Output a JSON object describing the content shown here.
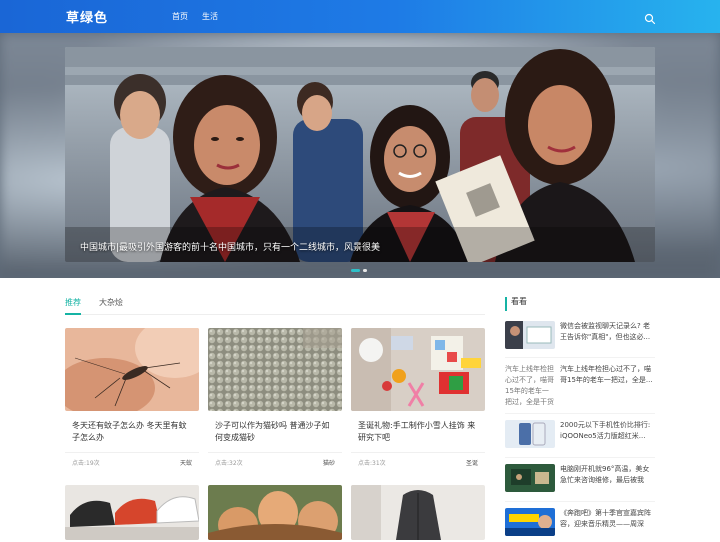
{
  "header": {
    "logo": "草绿色",
    "nav": [
      "首页",
      "生活"
    ]
  },
  "hero": {
    "caption": "中国城市|最吸引外国游客的前十名中国城市，只有一个二线城市，风景很美",
    "slide_count": 2,
    "active_slide": 1
  },
  "tabs": [
    "推荐",
    "大杂烩"
  ],
  "active_tab": 0,
  "cards": [
    {
      "title": "冬天还有蚊子怎么办 冬天里有蚊子怎么办",
      "clicks": "点击:19次",
      "category": "天蚁"
    },
    {
      "title": "沙子可以作为猫砂吗 普通沙子如何变成猫砂",
      "clicks": "点击:32次",
      "category": "猫砂"
    },
    {
      "title": "圣诞礼物:手工制作小雪人挂饰 来研究下吧",
      "clicks": "点击:31次",
      "category": "圣诞"
    }
  ],
  "sidebar": {
    "heading": "看看",
    "items": [
      {
        "text": "微信会被监视聊天记录么? 老王告诉你\"真相\"，但也这必..."
      },
      {
        "text": "汽车上线年检担心过不了，喵哥15年的老车一把过，全是...",
        "image_alt": "汽车上线年检担心过不了，喵哥15年的老车一把过，全是干货"
      },
      {
        "text": "2000元以下手机性价比排行: iQOONeo5活力版超红米..."
      },
      {
        "text": "电脑刚开机就96°高温，美女急忙来咨询维修，最后被我拍..."
      },
      {
        "text": "《奔跑吧》第十季官宣嘉宾阵容，迎来音乐精灵——周深"
      }
    ]
  },
  "colors": {
    "accent": "#15b3a4",
    "header_start": "#1a66d6",
    "header_end": "#27b3ee"
  },
  "icons": {
    "search": "search-icon"
  }
}
